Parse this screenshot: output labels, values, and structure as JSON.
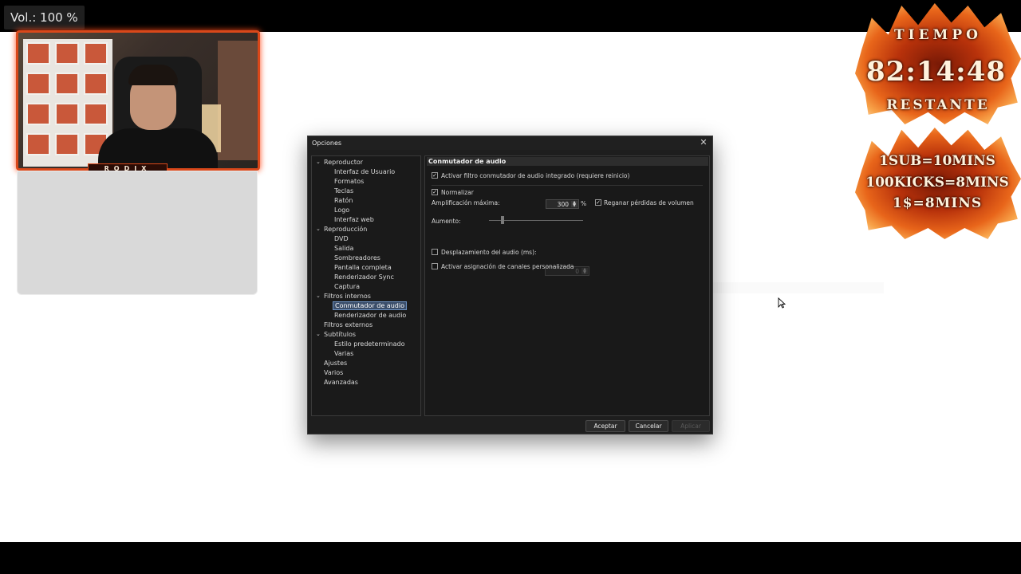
{
  "osd": {
    "volume": "Vol.: 100 %"
  },
  "webcam": {
    "label": "RODIX"
  },
  "timer": {
    "title": "TIEMPO",
    "value": "82:14:48",
    "subtitle": "RESTANTE",
    "rules": [
      "1SUB=10MINS",
      "100KICKS=8MINS",
      "1$=8MINS"
    ]
  },
  "dialog": {
    "title": "Opciones",
    "tree": [
      {
        "label": "Reproductor",
        "level": 0,
        "expanded": true
      },
      {
        "label": "Interfaz de Usuario",
        "level": 1
      },
      {
        "label": "Formatos",
        "level": 1
      },
      {
        "label": "Teclas",
        "level": 1
      },
      {
        "label": "Ratón",
        "level": 1
      },
      {
        "label": "Logo",
        "level": 1
      },
      {
        "label": "Interfaz web",
        "level": 1
      },
      {
        "label": "Reproducción",
        "level": 0,
        "expanded": true
      },
      {
        "label": "DVD",
        "level": 1
      },
      {
        "label": "Salida",
        "level": 1
      },
      {
        "label": "Sombreadores",
        "level": 1
      },
      {
        "label": "Pantalla completa",
        "level": 1
      },
      {
        "label": "Renderizador Sync",
        "level": 1
      },
      {
        "label": "Captura",
        "level": 1
      },
      {
        "label": "Filtros internos",
        "level": 0,
        "expanded": true
      },
      {
        "label": "Conmutador de audio",
        "level": 1,
        "selected": true
      },
      {
        "label": "Renderizador de audio",
        "level": 1
      },
      {
        "label": "Filtros externos",
        "level": 0
      },
      {
        "label": "Subtítulos",
        "level": 0,
        "expanded": true
      },
      {
        "label": "Estilo predeterminado",
        "level": 1
      },
      {
        "label": "Varias",
        "level": 1
      },
      {
        "label": "Ajustes",
        "level": 0
      },
      {
        "label": "Varios",
        "level": 0
      },
      {
        "label": "Avanzadas",
        "level": 0
      }
    ],
    "panel": {
      "header": "Conmutador de audio",
      "enable_switcher": {
        "label": "Activar filtro conmutador de audio integrado (requiere reinicio)",
        "checked": true
      },
      "normalize": {
        "label": "Normalizar",
        "checked": true
      },
      "max_amp": {
        "label": "Amplificación máxima:",
        "value": "300",
        "unit": "%"
      },
      "regain": {
        "label": "Reganar pérdidas de volumen",
        "checked": true
      },
      "boost": {
        "label": "Aumento:",
        "level": 0.15
      },
      "audio_shift": {
        "label": "Desplazamiento del audio (ms):",
        "value": "0",
        "checked": false
      },
      "custom_channels": {
        "label": "Activar asignación de canales personalizada",
        "checked": false
      }
    },
    "buttons": {
      "accept": "Aceptar",
      "cancel": "Cancelar",
      "apply": "Aplicar"
    }
  }
}
